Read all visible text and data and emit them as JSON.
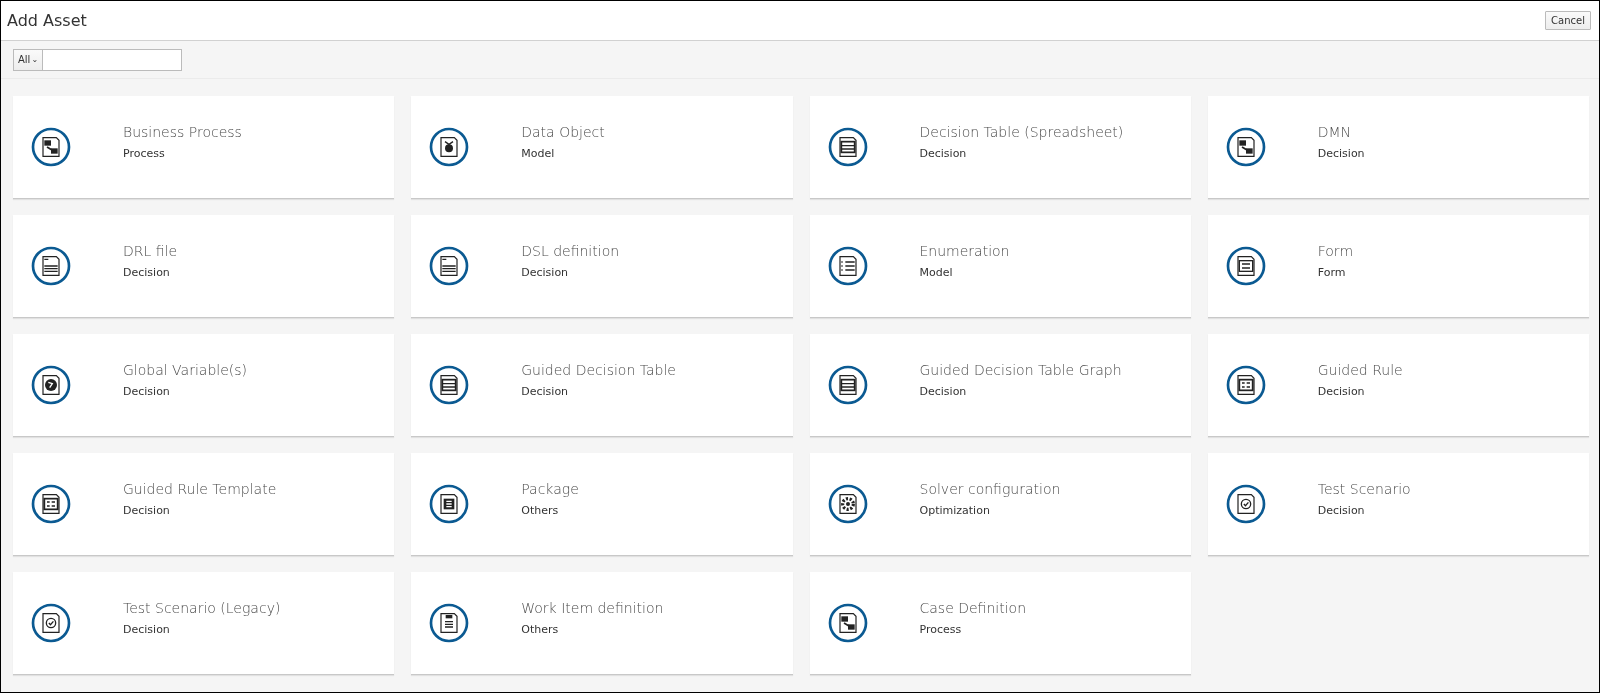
{
  "window": {
    "title": "Add Asset"
  },
  "header": {
    "cancel_button": "Cancel"
  },
  "filter": {
    "dropdown": "All",
    "caret": "⌄"
  },
  "assets": [
    {
      "title": "Business Process",
      "category": "Process",
      "kind": "process"
    },
    {
      "title": "Data Object",
      "category": "Model",
      "kind": "data"
    },
    {
      "title": "Decision Table (Spreadsheet)",
      "category": "Decision",
      "kind": "table"
    },
    {
      "title": "DMN",
      "category": "Decision",
      "kind": "process"
    },
    {
      "title": "DRL file",
      "category": "Decision",
      "kind": "text"
    },
    {
      "title": "DSL definition",
      "category": "Decision",
      "kind": "text"
    },
    {
      "title": "Enumeration",
      "category": "Model",
      "kind": "list"
    },
    {
      "title": "Form",
      "category": "Form",
      "kind": "form"
    },
    {
      "title": "Global Variable(s)",
      "category": "Decision",
      "kind": "globe"
    },
    {
      "title": "Guided Decision Table",
      "category": "Decision",
      "kind": "table"
    },
    {
      "title": "Guided Decision Table Graph",
      "category": "Decision",
      "kind": "table"
    },
    {
      "title": "Guided Rule",
      "category": "Decision",
      "kind": "rule"
    },
    {
      "title": "Guided Rule Template",
      "category": "Decision",
      "kind": "rule"
    },
    {
      "title": "Package",
      "category": "Others",
      "kind": "package"
    },
    {
      "title": "Solver configuration",
      "category": "Optimization",
      "kind": "gear"
    },
    {
      "title": "Test Scenario",
      "category": "Decision",
      "kind": "check"
    },
    {
      "title": "Test Scenario (Legacy)",
      "category": "Decision",
      "kind": "check"
    },
    {
      "title": "Work Item definition",
      "category": "Others",
      "kind": "clipboard"
    },
    {
      "title": "Case Definition",
      "category": "Process",
      "kind": "process"
    }
  ]
}
